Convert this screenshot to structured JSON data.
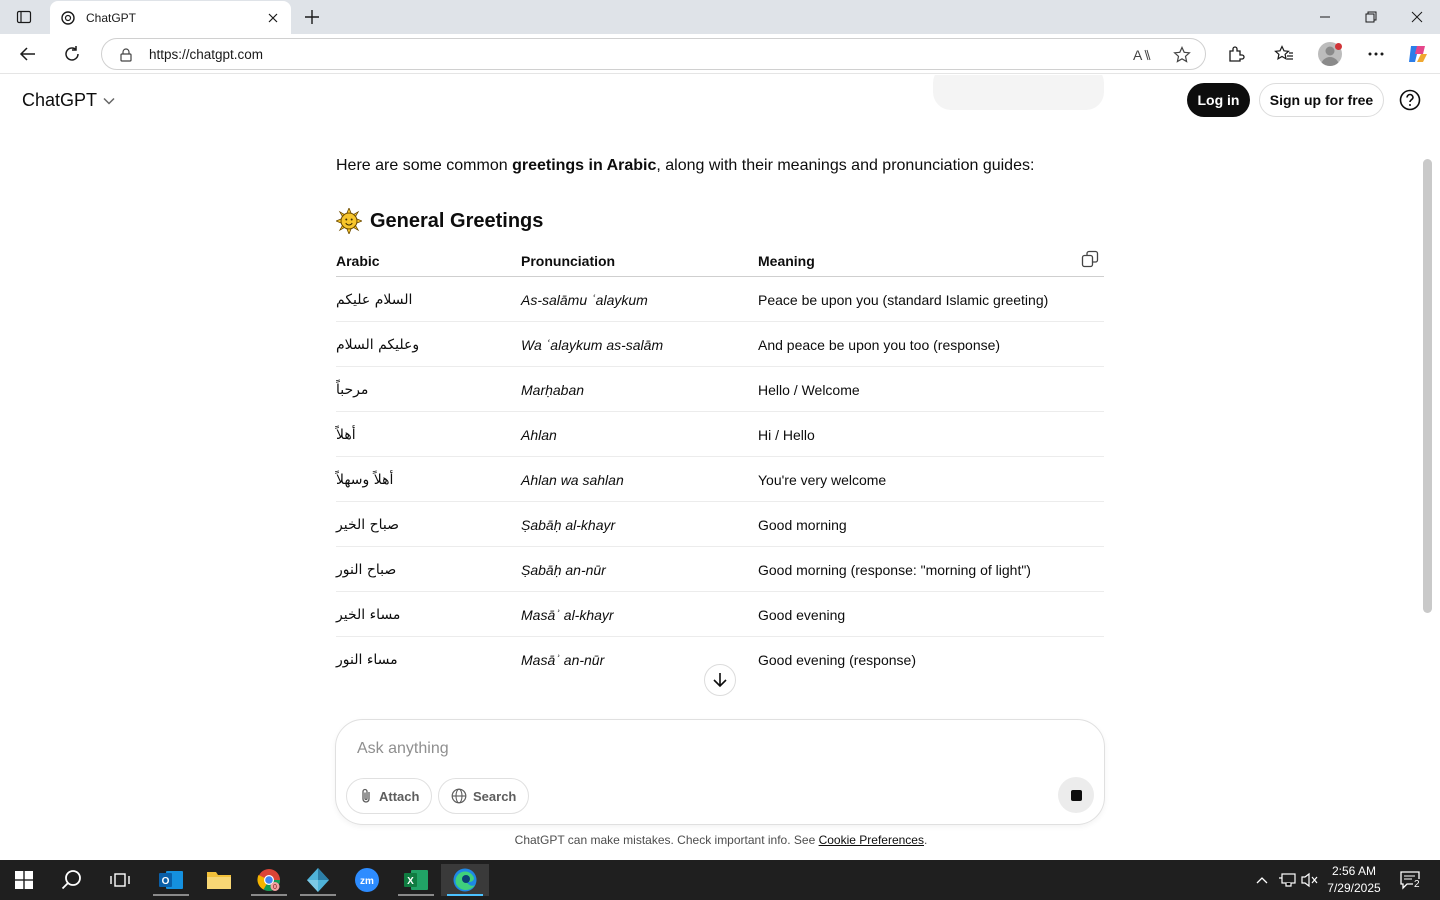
{
  "browser": {
    "tab_title": "ChatGPT",
    "url": "https://chatgpt.com"
  },
  "header": {
    "brand": "ChatGPT",
    "login_label": "Log in",
    "signup_label": "Sign up for free"
  },
  "content": {
    "intro_prefix": "Here are some common ",
    "intro_bold": "greetings in Arabic",
    "intro_suffix": ", along with their meanings and pronunciation guides:",
    "section_icon": "sun-icon",
    "section_title": "General Greetings",
    "table": {
      "headers": [
        "Arabic",
        "Pronunciation",
        "Meaning"
      ],
      "rows": [
        {
          "arabic": "السلام عليكم",
          "pron": "As-salāmu ʿalaykum",
          "meaning": "Peace be upon you (standard Islamic greeting)"
        },
        {
          "arabic": "وعليكم السلام",
          "pron": "Wa ʿalaykum as-salām",
          "meaning": "And peace be upon you too (response)"
        },
        {
          "arabic": "مرحباً",
          "pron": "Marḥaban",
          "meaning": "Hello / Welcome"
        },
        {
          "arabic": "أهلاً",
          "pron": "Ahlan",
          "meaning": "Hi / Hello"
        },
        {
          "arabic": "أهلاً وسهلاً",
          "pron": "Ahlan wa sahlan",
          "meaning": "You're very welcome"
        },
        {
          "arabic": "صباح الخير",
          "pron": "Ṣabāḥ al-khayr",
          "meaning": "Good morning"
        },
        {
          "arabic": "صباح النور",
          "pron": "Ṣabāḥ an-nūr",
          "meaning": "Good morning (response: \"morning of light\")"
        },
        {
          "arabic": "مساء الخير",
          "pron": "Masāʾ al-khayr",
          "meaning": "Good evening"
        },
        {
          "arabic": "مساء النور",
          "pron": "Masāʾ an-nūr",
          "meaning": "Good evening (response)"
        }
      ]
    }
  },
  "composer": {
    "placeholder": "Ask anything",
    "attach_label": "Attach",
    "search_label": "Search"
  },
  "footer": {
    "disclaimer": "ChatGPT can make mistakes. Check important info. See ",
    "cookie_link": "Cookie Preferences",
    "disclaimer_end": "."
  },
  "taskbar": {
    "time": "2:56 AM",
    "date": "7/29/2025",
    "notification_count": "2"
  },
  "colors": {
    "accent_dark": "#0d0d0d",
    "taskbar": "#1f1f1f",
    "titlebar": "#dfe3e8"
  }
}
